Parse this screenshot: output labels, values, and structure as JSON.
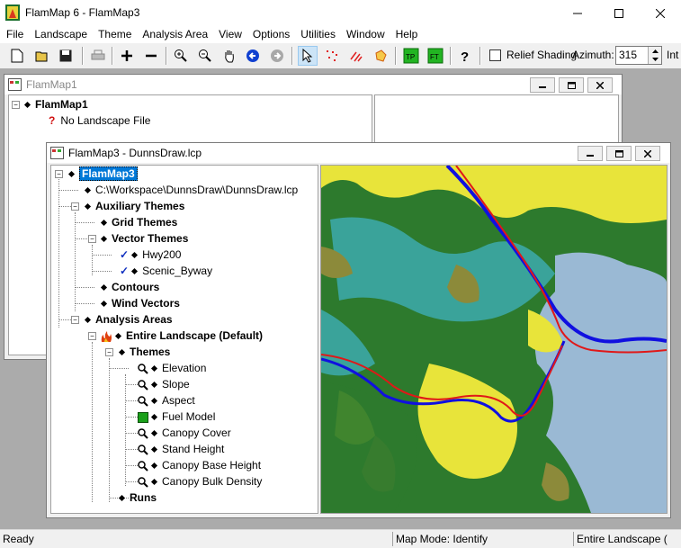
{
  "app": {
    "title": "FlamMap 6 - FlamMap3"
  },
  "menu": [
    "File",
    "Landscape",
    "Theme",
    "Analysis Area",
    "View",
    "Options",
    "Utilities",
    "Window",
    "Help"
  ],
  "toolbar": {
    "relief_label": "Relief Shading",
    "azimuth_label": "Azimuth:",
    "azimuth_value": "315",
    "trail_label": "Int"
  },
  "win1": {
    "title": "FlamMap1",
    "root": "FlamMap1",
    "no_file": "No Landscape File"
  },
  "win3": {
    "title": "FlamMap3 - DunnsDraw.lcp",
    "tree": {
      "root": "FlamMap3",
      "path": "C:\\Workspace\\DunnsDraw\\DunnsDraw.lcp",
      "aux": "Auxiliary Themes",
      "grid": "Grid Themes",
      "vector": "Vector Themes",
      "hwy": "Hwy200",
      "scenic": "Scenic_Byway",
      "contours": "Contours",
      "wind": "Wind Vectors",
      "areas": "Analysis Areas",
      "entire": "Entire Landscape (Default)",
      "themes": "Themes",
      "t_elev": "Elevation",
      "t_slope": "Slope",
      "t_aspect": "Aspect",
      "t_fuel": "Fuel Model",
      "t_cc": "Canopy Cover",
      "t_sh": "Stand Height",
      "t_cbh": "Canopy Base Height",
      "t_cbd": "Canopy Bulk Density",
      "runs": "Runs"
    }
  },
  "status": {
    "ready": "Ready",
    "mode": "Map Mode: Identify",
    "area": "Entire Landscape ("
  },
  "colors": {
    "yellow": "#e8e43a",
    "green": "#2d7a2d",
    "teal": "#3aa39a",
    "light_blue": "#9ab9d4",
    "olive": "#8c8a3a",
    "river": "#1010e0",
    "road": "#e01818"
  }
}
